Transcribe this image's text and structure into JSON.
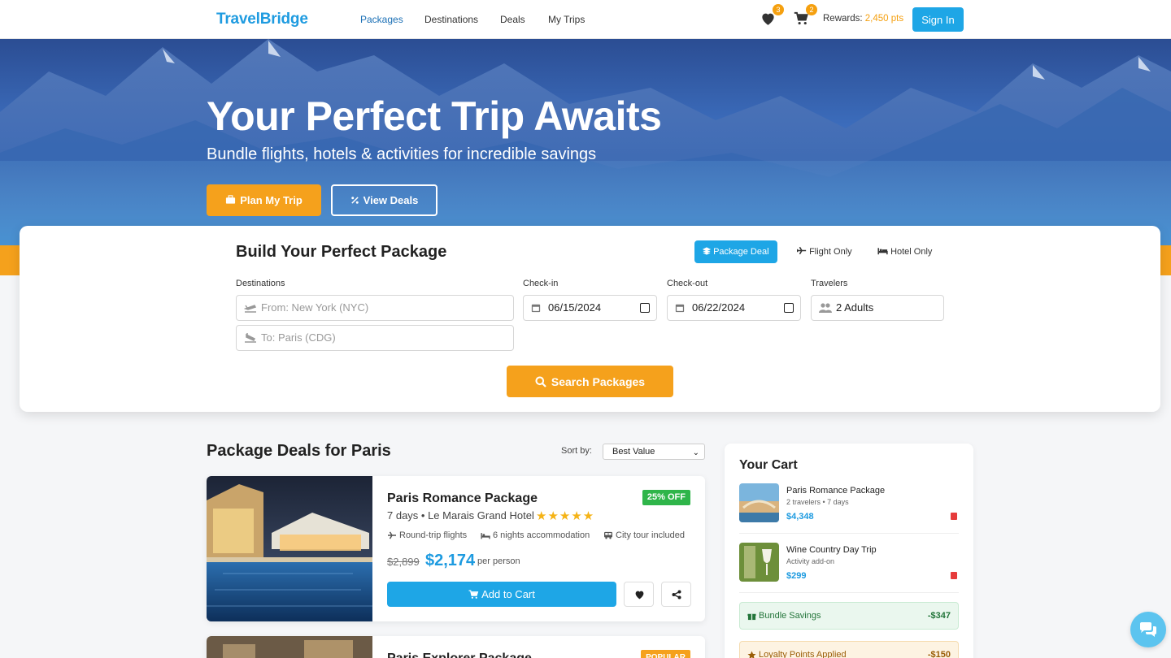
{
  "nav": {
    "logo": "TravelBridge",
    "links": [
      "Packages",
      "Destinations",
      "Deals",
      "My Trips"
    ],
    "wishlist_count": "3",
    "cart_count": "2",
    "rewards_label": "Rewards:",
    "rewards_value": "2,450 pts",
    "signin_label": "Sign In"
  },
  "hero": {
    "title": "Your Perfect Trip Awaits",
    "subtitle": "Bundle flights, hotels & activities for incredible savings",
    "plan_button": "Plan My Trip",
    "deals_button": "View Deals"
  },
  "search": {
    "title": "Build Your Perfect Package",
    "tabs": [
      "Package Deal",
      "Flight Only",
      "Hotel Only"
    ],
    "active_tab": "Package Deal",
    "destinations_label": "Destinations",
    "from_placeholder": "From: New York (NYC)",
    "to_placeholder": "To: Paris (CDG)",
    "checkin_label": "Check-in",
    "checkin_value": "06/15/2024",
    "checkout_label": "Check-out",
    "checkout_value": "06/22/2024",
    "travelers_label": "Travelers",
    "travelers_value": "2 Adults",
    "search_button": "Search Packages"
  },
  "deals": {
    "title": "Package Deals for Paris",
    "sort_label": "Sort by:",
    "sort_value": "Best Value",
    "packages": [
      {
        "name": "Paris Romance Package",
        "badge": "25% OFF",
        "subtitle": "7 days • Le Marais Grand Hotel",
        "rating": 5,
        "stars_text": "★★★★★",
        "features": [
          "Round-trip flights",
          "6 nights accommodation",
          "City tour included"
        ],
        "old_price": "$2,899",
        "price": "$2,174",
        "per": "per person",
        "add_button": "Add to Cart"
      },
      {
        "name": "Paris Explorer Package",
        "badge": "POPULAR"
      }
    ]
  },
  "cart": {
    "title": "Your Cart",
    "items": [
      {
        "name": "Paris Romance Package",
        "meta": "2 travelers • 7 days",
        "price": "$4,348"
      },
      {
        "name": "Wine Country Day Trip",
        "meta": "Activity add-on",
        "price": "$299"
      }
    ],
    "savings_label": "Bundle Savings",
    "savings_value": "-$347",
    "loyalty_label": "Loyalty Points Applied",
    "loyalty_value": "-$150"
  },
  "colors": {
    "brand": "#1e9be0",
    "accent": "#f5a11c",
    "success": "#2fb54a"
  },
  "icons": [
    "heart-icon",
    "cart-icon",
    "suitcase-icon",
    "percent-icon",
    "layers-icon",
    "plane-icon",
    "bed-icon",
    "plane-departure-icon",
    "plane-arrival-icon",
    "calendar-icon",
    "users-icon",
    "search-icon",
    "bus-icon",
    "share-icon",
    "trash-icon",
    "gift-icon",
    "star-icon",
    "chat-icon"
  ]
}
